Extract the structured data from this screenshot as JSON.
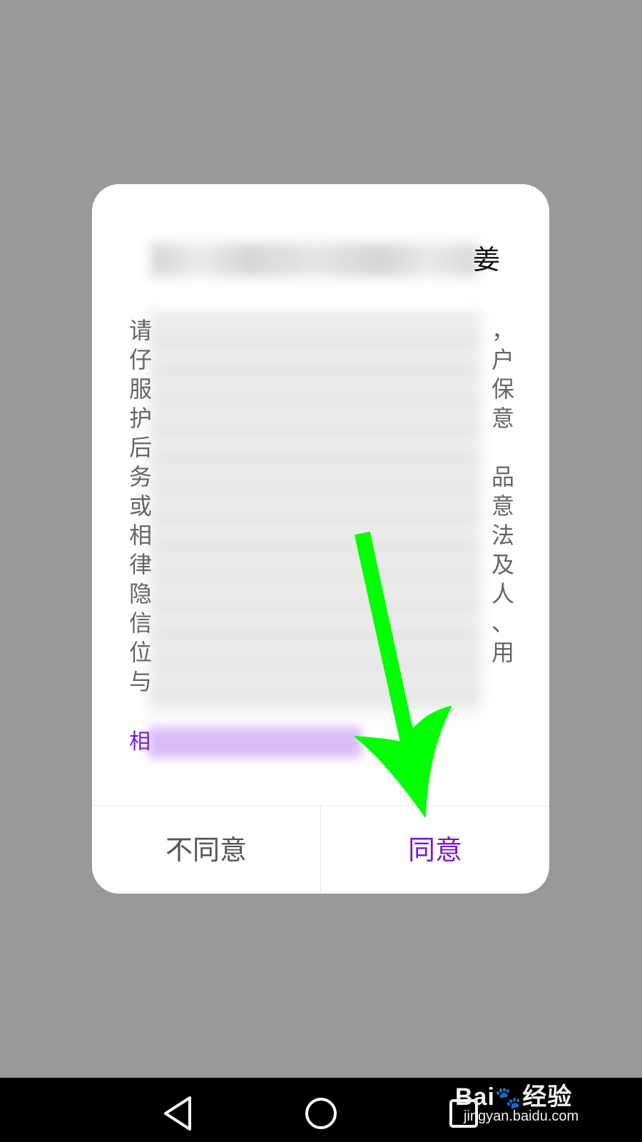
{
  "dialog": {
    "title_visible_tail": "姜",
    "body_lines": [
      {
        "lead": "请",
        "trail": "，"
      },
      {
        "lead": "仔",
        "trail": "户"
      },
      {
        "lead": "服",
        "trail": "保"
      },
      {
        "lead": "护",
        "trail": "意"
      },
      {
        "lead": "后",
        "trail": ""
      },
      {
        "lead": "务",
        "trail": "品"
      },
      {
        "lead": "或",
        "trail": "意"
      },
      {
        "lead": "相",
        "trail": "法"
      },
      {
        "lead": "律",
        "trail": "及"
      },
      {
        "lead": "隐",
        "trail": "人"
      },
      {
        "lead": "信",
        "trail": "、"
      },
      {
        "lead": "位",
        "trail": "用"
      },
      {
        "lead": "与",
        "trail": ""
      }
    ],
    "link_lead": "相",
    "disagree_label": "不同意",
    "agree_label": "同意"
  },
  "navbar": {
    "back_icon": "triangle-back-icon",
    "home_icon": "circle-home-icon",
    "recents_icon": "square-recents-icon"
  },
  "watermark": {
    "brand": "Bai",
    "brand_suffix": "经验",
    "url": "jingyan.baidu.com"
  },
  "colors": {
    "overlay": "#999999",
    "accent": "#7b19d8",
    "arrow": "#00ff00"
  }
}
